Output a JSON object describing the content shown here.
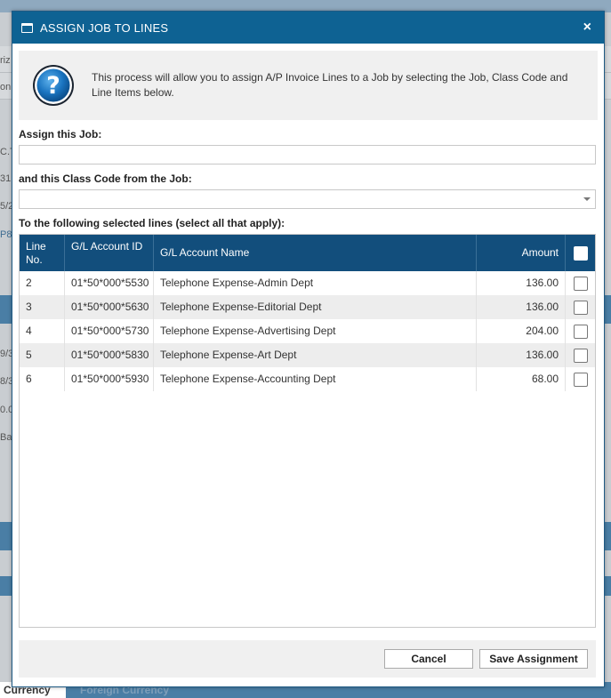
{
  "dialog": {
    "title": "ASSIGN JOB TO LINES",
    "close_glyph": "×",
    "info_text": "This process will allow you to assign A/P Invoice Lines to a Job by selecting the Job, Class Code and Line Items below.",
    "help_icon": "question-mark-circle-icon"
  },
  "form": {
    "job_label": "Assign this Job:",
    "job_value": "",
    "class_code_label": "and this Class Code from the Job:",
    "class_code_value": "",
    "lines_label": "To the following selected lines (select all that apply):"
  },
  "grid": {
    "columns": {
      "line_no": "Line No.",
      "account_id": "G/L Account ID",
      "account_name": "G/L Account Name",
      "amount": "Amount"
    },
    "rows": [
      {
        "line": "2",
        "account_id": "01*50*000*5530",
        "account_name": "Telephone Expense-Admin Dept",
        "amount": "136.00",
        "checked": false
      },
      {
        "line": "3",
        "account_id": "01*50*000*5630",
        "account_name": "Telephone Expense-Editorial Dept",
        "amount": "136.00",
        "checked": false
      },
      {
        "line": "4",
        "account_id": "01*50*000*5730",
        "account_name": "Telephone Expense-Advertising Dept",
        "amount": "204.00",
        "checked": false
      },
      {
        "line": "5",
        "account_id": "01*50*000*5830",
        "account_name": "Telephone Expense-Art Dept",
        "amount": "136.00",
        "checked": false
      },
      {
        "line": "6",
        "account_id": "01*50*000*5930",
        "account_name": "Telephone Expense-Accounting Dept",
        "amount": "68.00",
        "checked": false
      }
    ]
  },
  "buttons": {
    "cancel": "Cancel",
    "save": "Save Assignment"
  },
  "background": {
    "fragments_left": [
      "riz",
      "on",
      "C.T",
      "31",
      "5/2",
      "P8",
      "9/3",
      "8/3",
      "0.0",
      "Ba"
    ],
    "tab_active": "Currency",
    "tab_inactive": "Foreign Currency"
  },
  "colors": {
    "header_bg": "#0e6293",
    "grid_header_bg": "#124e7c",
    "row_alt_bg": "#ededed"
  }
}
